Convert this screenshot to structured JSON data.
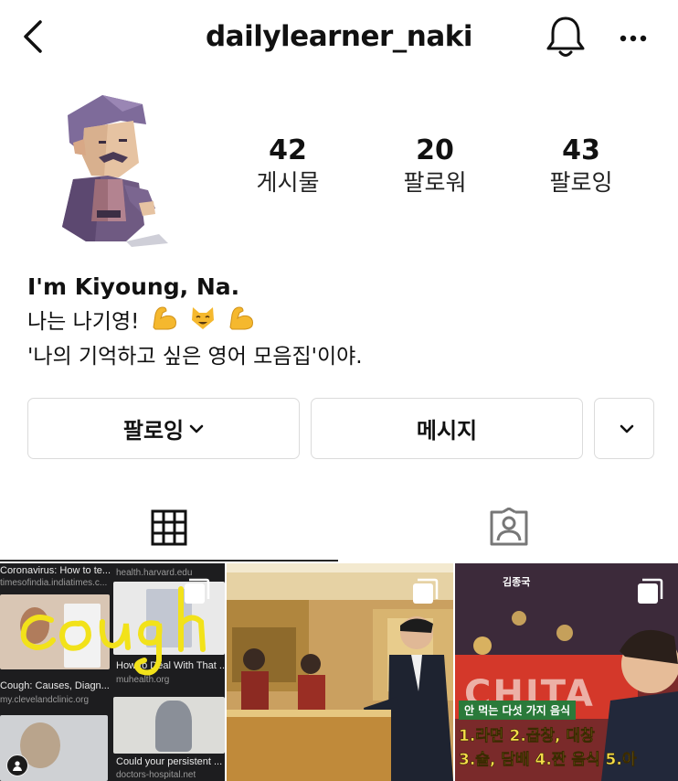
{
  "header": {
    "username": "dailylearner_naki",
    "back_icon": "chevron-left-icon",
    "notification_icon": "bell-icon",
    "more_icon": "more-horizontal-icon"
  },
  "profile": {
    "avatar_icon": "cartoon-avatar-icon",
    "stats": [
      {
        "value": "42",
        "label": "게시물"
      },
      {
        "value": "20",
        "label": "팔로워"
      },
      {
        "value": "43",
        "label": "팔로잉"
      }
    ],
    "bio": {
      "name": "I'm Kiyoung, Na.",
      "line1": "나는 나기영!",
      "line1_emojis": [
        "flexed-biceps-icon",
        "smiling-cat-icon",
        "flexed-biceps-icon"
      ],
      "line2": "'나의 기억하고 싶은 영어 모음집'이야."
    }
  },
  "actions": {
    "following_label": "팔로잉",
    "message_label": "메시지",
    "suggest_icon": "chevron-down-icon"
  },
  "tabs": {
    "grid_icon": "grid-icon",
    "tagged_icon": "tagged-person-icon"
  },
  "posts": [
    {
      "type": "multi",
      "results": [
        {
          "title": "Coronavirus: How to te...",
          "source": "timesofindia.indiatimes.c..."
        },
        {
          "title": "",
          "source": "health.harvard.edu"
        },
        {
          "title": "How to Deal With That ...",
          "source": "muhealth.org"
        },
        {
          "title": "Cough: Causes, Diagn...",
          "source": "my.clevelandclinic.org"
        },
        {
          "title": "Could your persistent ...",
          "source": "doctors-hospital.net"
        }
      ],
      "handwriting": "cough"
    },
    {
      "type": "multi"
    },
    {
      "type": "multi",
      "caption_top": "안 먹는 다섯 가지 음식",
      "caption_line1": "1.라면 2.곱창, 대창",
      "caption_line2": "3.술, 담배 4.짠 음식 5.아",
      "sign_text": "CHITA",
      "corner_tag": "김종국"
    }
  ],
  "colors": {
    "text": "#262626",
    "border": "#dbdbdb",
    "highlighter": "#f2e21a"
  }
}
